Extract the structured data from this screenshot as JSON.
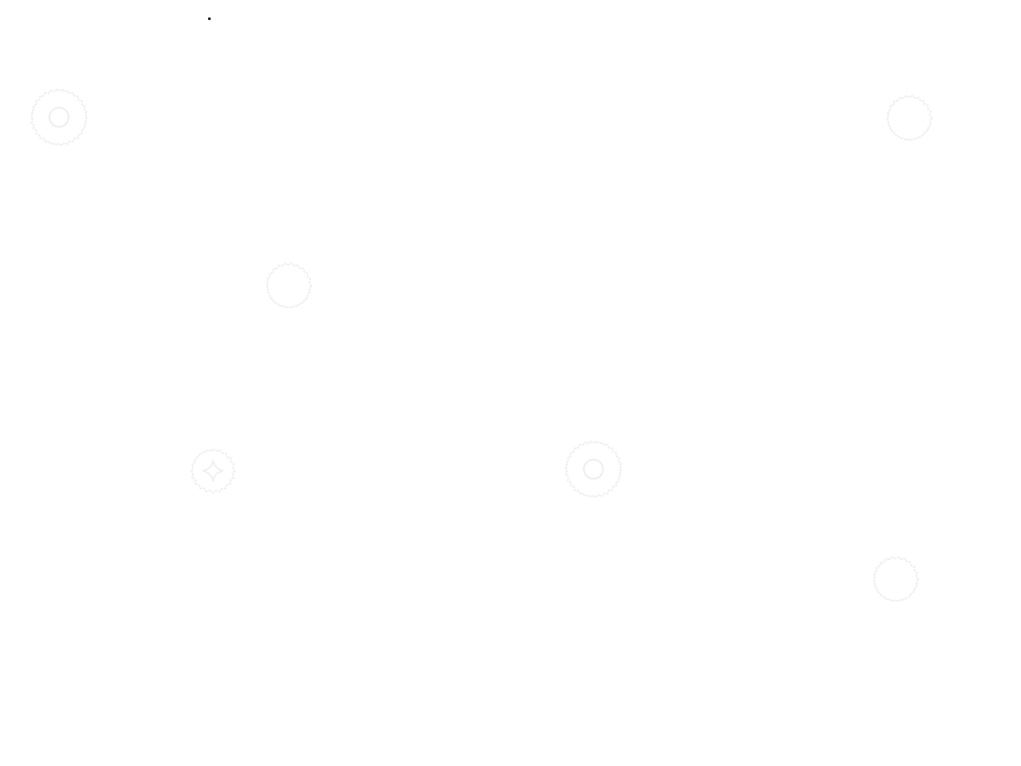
{
  "desktop": {
    "background_color": "#ffffff",
    "decoration_color": "#ececec",
    "decorations": [
      {
        "icon": "gear-icon",
        "style": "ring"
      },
      {
        "icon": "gear-icon",
        "style": "plain"
      },
      {
        "icon": "gear-icon",
        "style": "plain"
      },
      {
        "icon": "gear-icon",
        "style": "star"
      },
      {
        "icon": "gear-icon",
        "style": "ring"
      },
      {
        "icon": "gear-icon",
        "style": "plain"
      }
    ]
  },
  "cursor": {
    "icon": "mouse-pointer-icon",
    "color": "#000000"
  }
}
